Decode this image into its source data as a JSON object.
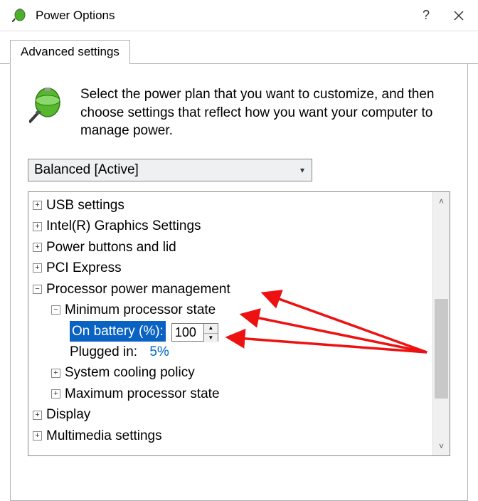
{
  "window": {
    "title": "Power Options"
  },
  "tab": {
    "label": "Advanced settings"
  },
  "intro": "Select the power plan that you want to customize, and then choose settings that reflect how you want your computer to manage power.",
  "plan": {
    "selected": "Balanced [Active]"
  },
  "tree": {
    "usb": "USB settings",
    "intel": "Intel(R) Graphics Settings",
    "powerbtn": "Power buttons and lid",
    "pci": "PCI Express",
    "ppm": "Processor power management",
    "minstate": "Minimum processor state",
    "onbatt_label": "On battery (%):",
    "onbatt_value": "100",
    "plugged_label": "Plugged in:",
    "plugged_value": "5%",
    "cooling": "System cooling policy",
    "maxstate": "Maximum processor state",
    "display": "Display",
    "multimedia": "Multimedia settings"
  }
}
